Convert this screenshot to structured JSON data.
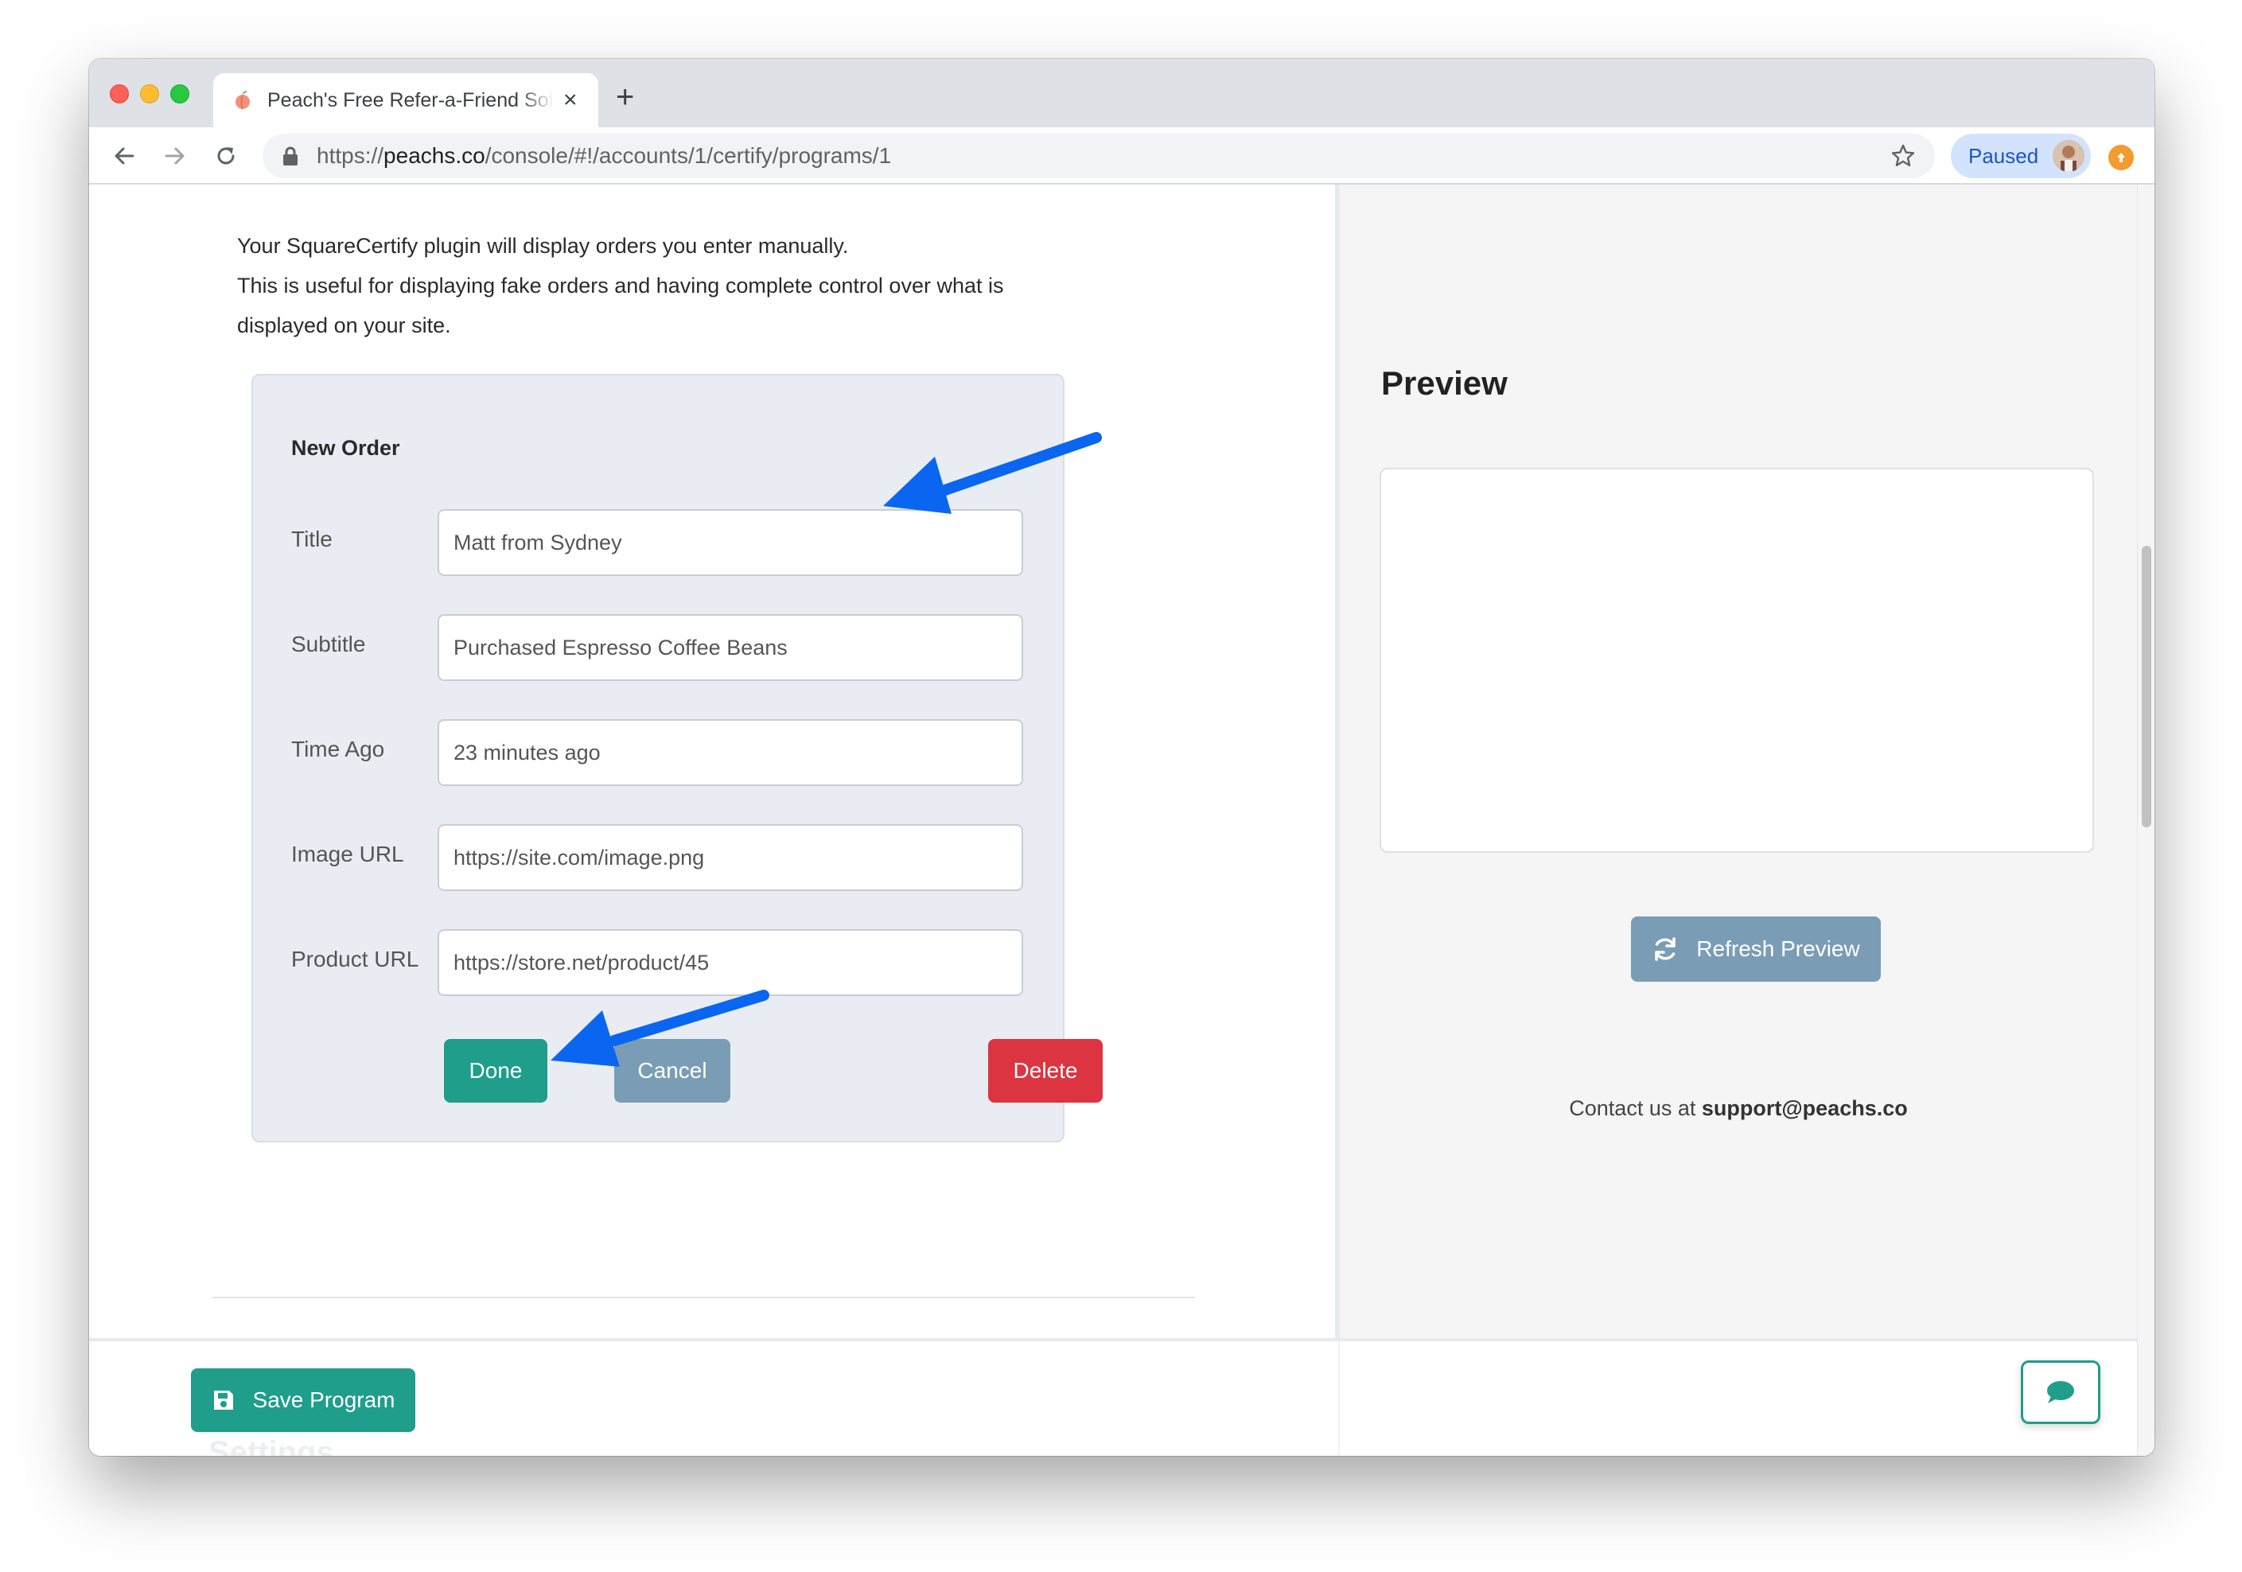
{
  "browser": {
    "tab_title": "Peach's Free Refer-a-Friend Software",
    "new_tab_icon": "plus-icon",
    "url_scheme": "https://",
    "url_host": "peachs.co",
    "url_path": "/console/#!/accounts/1/certify/programs/1",
    "profile_label": "Paused"
  },
  "intro": {
    "line1": "Your SquareCertify plugin will display orders you enter manually.",
    "line2": "This is useful for displaying fake orders and having complete control over what is",
    "line3": "displayed on your site."
  },
  "order_form": {
    "heading": "New Order",
    "fields": [
      {
        "label": "Title",
        "value": "Matt from Sydney"
      },
      {
        "label": "Subtitle",
        "value": "Purchased Espresso Coffee Beans"
      },
      {
        "label": "Time Ago",
        "value": "23 minutes ago"
      },
      {
        "label": "Image URL",
        "value": "https://site.com/image.png"
      },
      {
        "label": "Product URL",
        "value": "https://store.net/product/45"
      }
    ],
    "done_label": "Done",
    "cancel_label": "Cancel",
    "delete_label": "Delete"
  },
  "preview": {
    "title": "Preview",
    "refresh_label": "Refresh Preview",
    "contact_prefix": "Contact us at ",
    "contact_email": "support@peachs.co"
  },
  "footer": {
    "save_label": "Save Program",
    "partial_heading": "Settings",
    "chat_icon": "chat-bubble-icon"
  },
  "colors": {
    "primary": "#1e9e8b",
    "secondary": "#7a9db5",
    "danger": "#dc3440",
    "annotation_arrow": "#0a66f0"
  }
}
